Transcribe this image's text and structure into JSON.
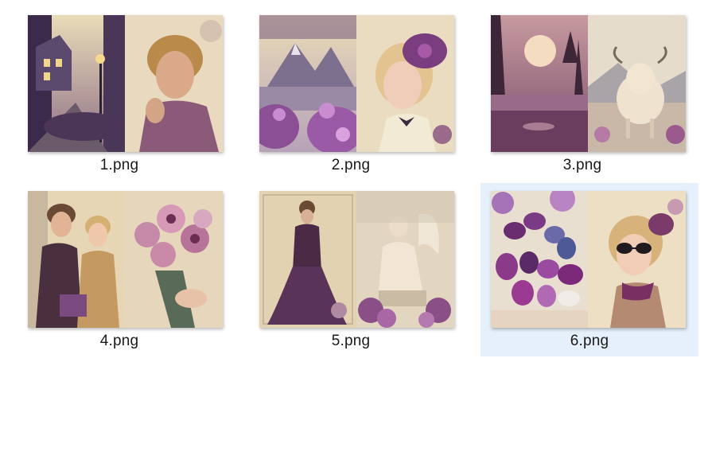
{
  "files": [
    {
      "name": "1.png",
      "selected": false
    },
    {
      "name": "2.png",
      "selected": false
    },
    {
      "name": "3.png",
      "selected": false
    },
    {
      "name": "4.png",
      "selected": false
    },
    {
      "name": "5.png",
      "selected": false
    },
    {
      "name": "6.png",
      "selected": true
    }
  ],
  "colors": {
    "selection_background": "#e5f0fb",
    "palette_plum": "#6b3a68",
    "palette_cream": "#ead9b8",
    "palette_lilac": "#a86cb0"
  }
}
